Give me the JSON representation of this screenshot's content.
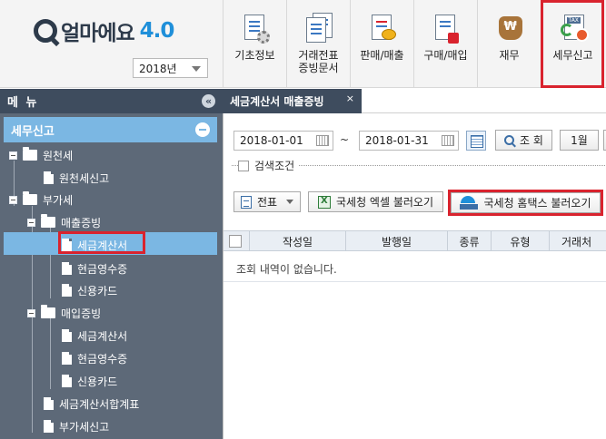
{
  "logo": {
    "name": "얼마에요",
    "version": "4.0"
  },
  "year": "2018년",
  "toolbar": {
    "items": [
      {
        "label": "기초정보"
      },
      {
        "label": "거래전표\n증빙문서"
      },
      {
        "label": "판매/매출"
      },
      {
        "label": "구매/매입"
      },
      {
        "label": "재무"
      },
      {
        "label": "세무신고"
      }
    ]
  },
  "sidebar": {
    "header": "메 뉴",
    "collapse": "«",
    "category": "세무신고",
    "tree": {
      "withholding": "원천세",
      "withholding_report": "원천세신고",
      "vat": "부가세",
      "sales_proof": "매출증빙",
      "sales_tax_invoice": "세금계산서",
      "sales_cash_receipt": "현금영수증",
      "sales_credit_card": "신용카드",
      "purchase_proof": "매입증빙",
      "purchase_tax_invoice": "세금계산서",
      "purchase_cash_receipt": "현금영수증",
      "purchase_credit_card": "신용카드",
      "tax_invoice_summary": "세금계산서합계표",
      "vat_report": "부가세신고"
    }
  },
  "tab": {
    "label": "세금계산서 매출증빙",
    "close": "×"
  },
  "filter": {
    "date_from": "2018-01-01",
    "tilde": "~",
    "date_to": "2018-01-31",
    "search_label": "조 회",
    "month_label": "1월",
    "condition_label": "검색조건"
  },
  "actions": {
    "voucher": "전표",
    "excel_import": "국세청 엑셀 불러오기",
    "hometax_import": "국세청 홈택스 불러오기"
  },
  "grid": {
    "columns": [
      "작성일",
      "발행일",
      "종류",
      "유형",
      "거래처"
    ],
    "empty_message": "조회 내역이 없습니다."
  },
  "colors": {
    "sidebar_bg": "#5d6978",
    "header_bg": "#3e4c5e",
    "selection": "#7bb7e3",
    "highlight": "#d9232e",
    "brand_blue": "#1f8fd9"
  }
}
